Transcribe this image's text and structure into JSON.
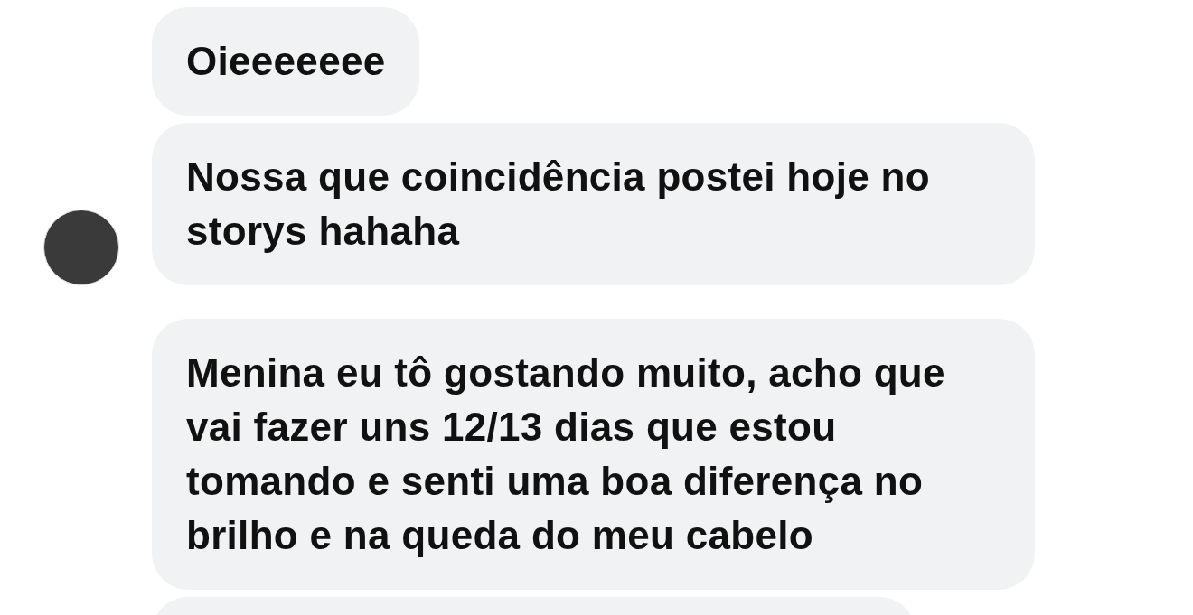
{
  "groups": [
    {
      "avatar": true,
      "messages": [
        {
          "kind": "text",
          "text": "Oieeeeeee"
        },
        {
          "kind": "text",
          "text": "Nossa que coincidência postei hoje no storys hahaha"
        }
      ]
    },
    {
      "avatar": false,
      "messages": [
        {
          "kind": "text",
          "text": "Menina eu tô gostando muito, acho que vai fazer uns 12/13 dias que estou tomando e senti uma boa diferença no brilho e na queda do meu cabelo"
        },
        {
          "kind": "clipped"
        }
      ]
    }
  ]
}
